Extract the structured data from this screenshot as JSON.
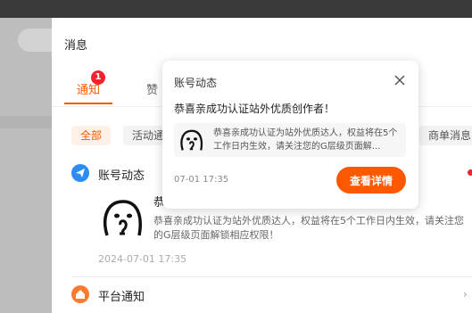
{
  "panel": {
    "title": "消息",
    "tabs": [
      {
        "label": "通知",
        "badge": "1",
        "active": true
      },
      {
        "label": "赞",
        "active": false
      }
    ],
    "filters": [
      {
        "label": "全部",
        "active": true
      },
      {
        "label": "活动通知",
        "active": false
      },
      {
        "label": "商单消息",
        "active": false
      }
    ],
    "sections": [
      {
        "title": "账号动态",
        "icon": "paper-plane-icon",
        "unread": true,
        "message": {
          "headline": "恭喜亲成功认证站外优质创作者！",
          "body": "恭喜亲成功认证为站外优质达人，权益将在5个工作日内生效，请关注您的G层级页面解锁相应权限！",
          "time": "2024-07-01 17:35"
        }
      },
      {
        "title": "平台通知",
        "icon": "house-icon"
      }
    ]
  },
  "popover": {
    "title": "账号动态",
    "headline": "恭喜亲成功认证站外优质创作者！",
    "card_text": "恭喜亲成功认证为站外优质达人，权益将在5个工作日内生效，请关注您的G层级页面解...",
    "time": "07-01 17:35",
    "button_label": "查看详情"
  },
  "colors": {
    "accent": "#fe5900",
    "badge": "#f5222d",
    "section_blue": "#2d8cf0",
    "section_orange": "#ff7a2e"
  }
}
